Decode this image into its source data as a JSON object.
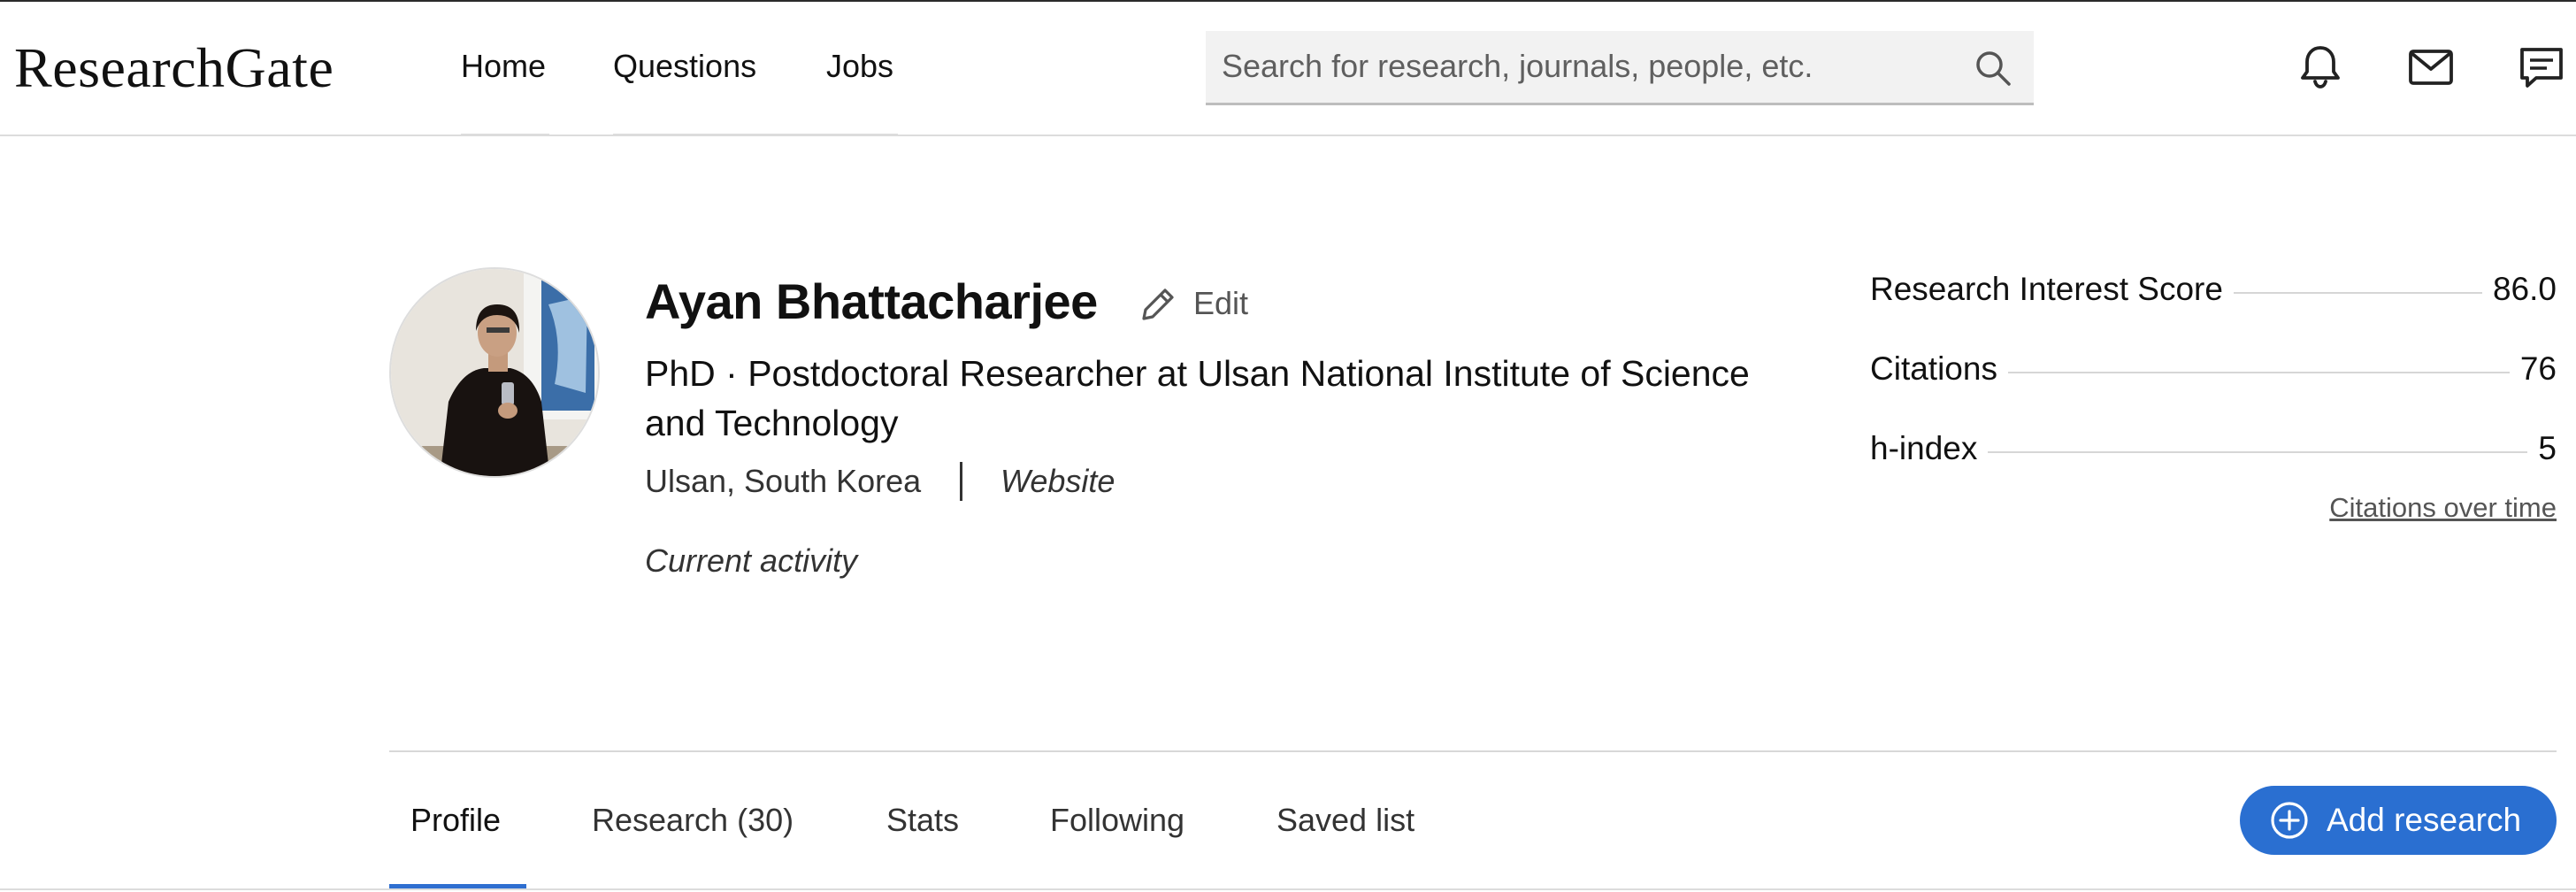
{
  "header": {
    "logo": "ResearchGate",
    "nav": [
      {
        "label": "Home"
      },
      {
        "label": "Questions"
      },
      {
        "label": "Jobs"
      }
    ],
    "search": {
      "placeholder": "Search for research, journals, people, etc.",
      "value": ""
    },
    "icons": [
      "search-icon",
      "bell-icon",
      "mail-icon",
      "chat-icon"
    ]
  },
  "profile": {
    "name": "Ayan Bhattacharjee",
    "edit_label": "Edit",
    "position": "PhD · Postdoctoral Researcher at Ulsan National Institute of Science and Technology",
    "location": "Ulsan, South Korea",
    "website_label": "Website",
    "activity_label": "Current activity"
  },
  "stats": [
    {
      "label": "Research Interest Score",
      "value": "86.0"
    },
    {
      "label": "Citations",
      "value": "76"
    },
    {
      "label": "h-index",
      "value": "5"
    }
  ],
  "citations_link": "Citations over time",
  "tabs": [
    {
      "label": "Profile",
      "active": true
    },
    {
      "label": "Research (30)",
      "active": false
    },
    {
      "label": "Stats",
      "active": false
    },
    {
      "label": "Following",
      "active": false
    },
    {
      "label": "Saved list",
      "active": false
    }
  ],
  "add_research_label": "Add research",
  "colors": {
    "accent": "#2a6fd1",
    "text": "#111111",
    "muted": "#555555",
    "divider": "#d8d8d8"
  }
}
